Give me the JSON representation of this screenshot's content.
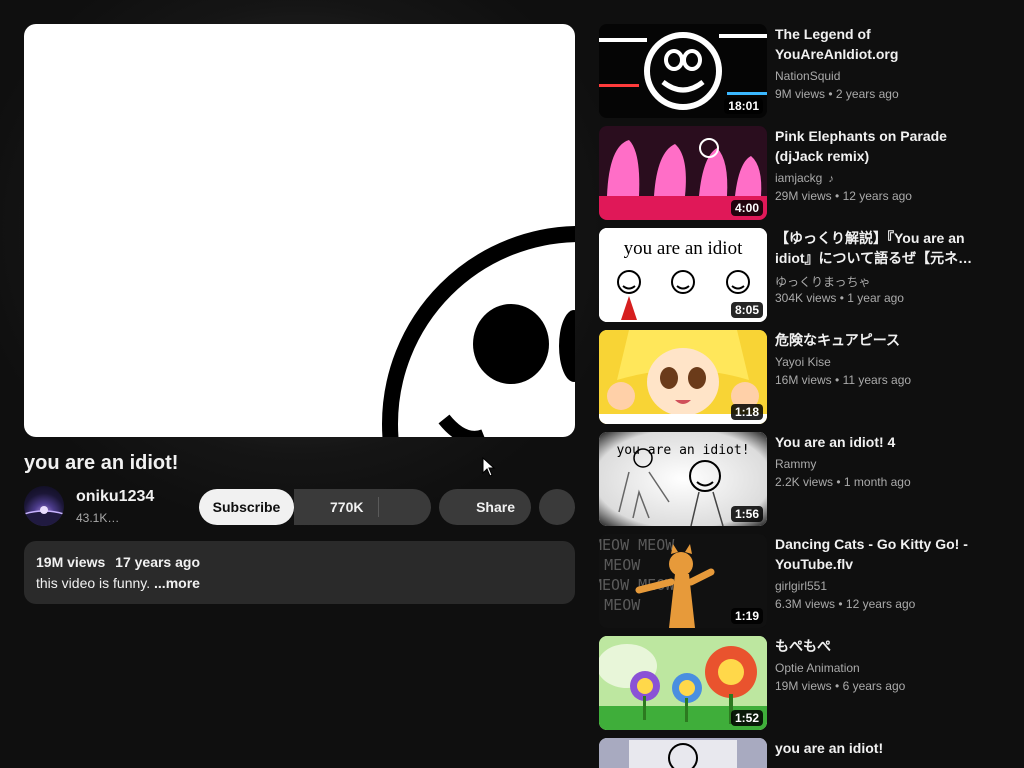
{
  "video": {
    "title": "you are an idiot!",
    "channel": "oniku1234",
    "subscribers": "43.1K…",
    "subscribe_label": "Subscribe",
    "likes": "770K",
    "share_label": "Share",
    "views": "19M views",
    "age": "17 years ago",
    "description": "this video is funny. ",
    "more_label": "...more"
  },
  "recommendations": [
    {
      "title": "The Legend of YouAreAnIdiot.org",
      "channel": "NationSquid",
      "views": "9M views",
      "age": "2 years ago",
      "duration": "18:01",
      "sep": "•"
    },
    {
      "title": "Pink Elephants on Parade (djJack remix)",
      "channel": "iamjackg",
      "views": "29M views",
      "age": "12 years ago",
      "duration": "4:00",
      "sep": "•",
      "channel_icon": "music-note-icon"
    },
    {
      "title": "【ゆっくり解説】『You are an idiot』について語るぜ【元ネ…",
      "channel": "ゆっくりまっちゃ",
      "views": "304K views",
      "age": "1 year ago",
      "duration": "8:05",
      "sep": "•",
      "thumb_text": "you are an idiot"
    },
    {
      "title": "危険なキュアピース",
      "channel": "Yayoi Kise",
      "views": "16M views",
      "age": "11 years ago",
      "duration": "1:18",
      "sep": "•"
    },
    {
      "title": "You are an idiot! 4",
      "channel": "Rammy",
      "views": "2.2K views",
      "age": "1 month ago",
      "duration": "1:56",
      "sep": "•",
      "thumb_text": "you are an idiot!"
    },
    {
      "title": "Dancing Cats - Go Kitty Go! - YouTube.flv",
      "channel": "girlgirl551",
      "views": "6.3M views",
      "age": "12 years ago",
      "duration": "1:19",
      "sep": "•",
      "thumb_text": "MEOW MEOW"
    },
    {
      "title": "もぺもぺ",
      "channel": "Optie Animation",
      "views": "19M views",
      "age": "6 years ago",
      "duration": "1:52",
      "sep": "•"
    },
    {
      "title": "you are an idiot!",
      "channel": "",
      "views": "",
      "age": "",
      "duration": "",
      "sep": ""
    }
  ]
}
